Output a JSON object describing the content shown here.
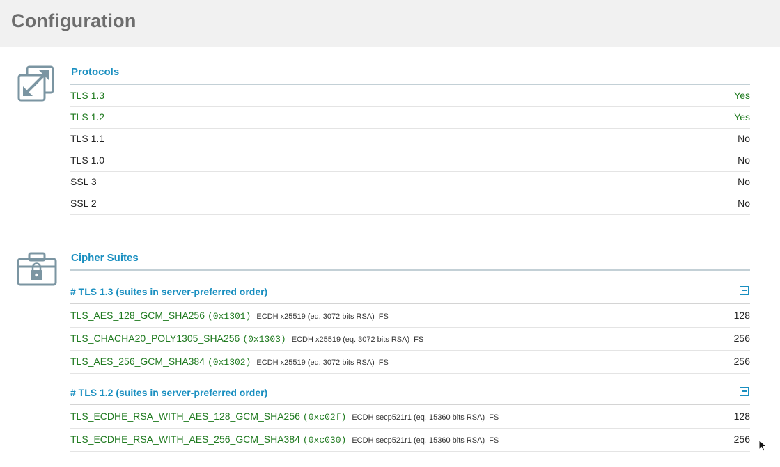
{
  "header": {
    "title": "Configuration"
  },
  "protocols": {
    "title": "Protocols",
    "icon": "resize-arrows-icon",
    "rows": [
      {
        "name": "TLS 1.3",
        "value": "Yes",
        "status": "yes"
      },
      {
        "name": "TLS 1.2",
        "value": "Yes",
        "status": "yes"
      },
      {
        "name": "TLS 1.1",
        "value": "No",
        "status": "no"
      },
      {
        "name": "TLS 1.0",
        "value": "No",
        "status": "no"
      },
      {
        "name": "SSL 3",
        "value": "No",
        "status": "no"
      },
      {
        "name": "SSL 2",
        "value": "No",
        "status": "no"
      }
    ]
  },
  "cipher_suites": {
    "title": "Cipher Suites",
    "icon": "toolbox-lock-icon",
    "groups": [
      {
        "header": "# TLS 1.3 (suites in server-preferred order)",
        "suites": [
          {
            "name": "TLS_AES_128_GCM_SHA256",
            "code": "(0x1301)",
            "detail": "ECDH x25519 (eq. 3072 bits RSA)",
            "fs": "FS",
            "bits": "128"
          },
          {
            "name": "TLS_CHACHA20_POLY1305_SHA256",
            "code": "(0x1303)",
            "detail": "ECDH x25519 (eq. 3072 bits RSA)",
            "fs": "FS",
            "bits": "256"
          },
          {
            "name": "TLS_AES_256_GCM_SHA384",
            "code": "(0x1302)",
            "detail": "ECDH x25519 (eq. 3072 bits RSA)",
            "fs": "FS",
            "bits": "256"
          }
        ]
      },
      {
        "header": "# TLS 1.2 (suites in server-preferred order)",
        "suites": [
          {
            "name": "TLS_ECDHE_RSA_WITH_AES_128_GCM_SHA256",
            "code": "(0xc02f)",
            "detail": "ECDH secp521r1 (eq. 15360 bits RSA)",
            "fs": "FS",
            "bits": "128"
          },
          {
            "name": "TLS_ECDHE_RSA_WITH_AES_256_GCM_SHA384",
            "code": "(0xc030)",
            "detail": "ECDH secp521r1 (eq. 15360 bits RSA)",
            "fs": "FS",
            "bits": "256"
          }
        ]
      }
    ]
  },
  "colors": {
    "accent": "#1a8fc0",
    "enabled": "#1f7a1f",
    "icon": "#7b95a2"
  }
}
